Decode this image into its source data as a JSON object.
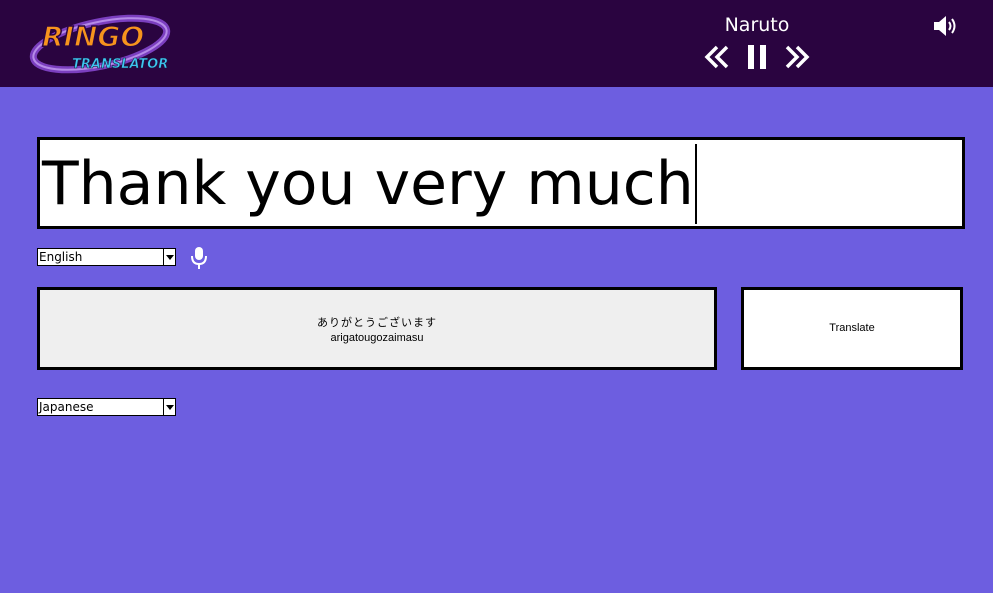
{
  "app": {
    "logo_text_top": "RINGO",
    "logo_text_bottom": "TRANSLATOR"
  },
  "player": {
    "song_title": "Naruto",
    "prev_icon": "double-chevron-left-icon",
    "pause_icon": "pause-icon",
    "next_icon": "double-chevron-right-icon",
    "volume_icon": "speaker-icon"
  },
  "input": {
    "value": "Thank you very much"
  },
  "source_language": {
    "selected": "English",
    "mic_icon": "microphone-icon"
  },
  "output": {
    "translation": "ありがとうございます",
    "romanization": "arigatougozaimasu"
  },
  "translate_button": {
    "label": "Translate"
  },
  "target_language": {
    "selected": "Japanese"
  },
  "colors": {
    "background": "#6d5ee0",
    "header": "#2a0440",
    "logo_orange": "#f7941d",
    "logo_blue": "#3ec6f0",
    "logo_ring": "#7b3fbf"
  }
}
